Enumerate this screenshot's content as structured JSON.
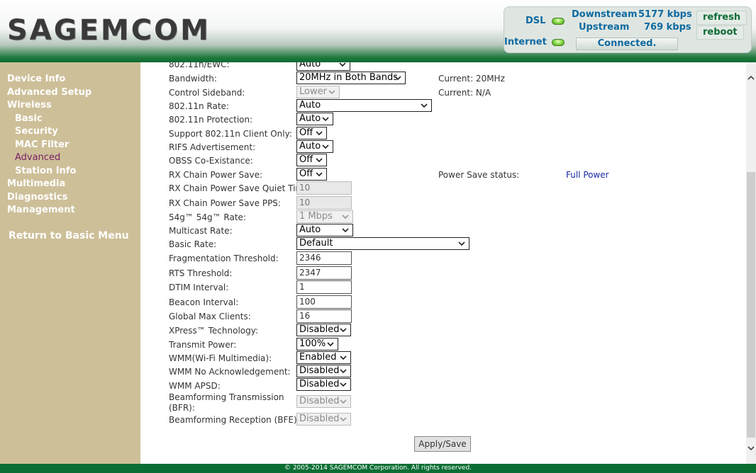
{
  "brand": {
    "logo": "SAGEMCOM"
  },
  "status": {
    "dsl_label": "DSL",
    "internet_label": "Internet",
    "downstream_label": "Downstream",
    "downstream_value": "5177 kbps",
    "upstream_label": "Upstream",
    "upstream_value": "769 kbps",
    "connection": "Connected.",
    "refresh_label": "refresh",
    "reboot_label": "reboot",
    "led_color": "#7ad33b"
  },
  "sidebar": {
    "device_info": "Device Info",
    "advanced_setup": "Advanced Setup",
    "wireless": "Wireless",
    "basic": "Basic",
    "security": "Security",
    "mac_filter": "MAC Filter",
    "advanced": "Advanced",
    "station_info": "Station Info",
    "multimedia": "Multimedia",
    "diagnostics": "Diagnostics",
    "management": "Management",
    "return_label": "Return to Basic Menu"
  },
  "form": {
    "ewc": {
      "label": "802.11n/EWC:",
      "value": "Auto"
    },
    "bandwidth": {
      "label": "Bandwidth:",
      "value": "20MHz in Both Bands",
      "current": "Current: 20MHz"
    },
    "control_sideband": {
      "label": "Control Sideband:",
      "value": "Lower",
      "current": "Current: N/A"
    },
    "n_rate": {
      "label": "802.11n Rate:",
      "value": "Auto"
    },
    "n_protection": {
      "label": "802.11n Protection:",
      "value": "Auto"
    },
    "n_client_only": {
      "label": "Support 802.11n Client Only:",
      "value": "Off"
    },
    "rifs": {
      "label": "RIFS Advertisement:",
      "value": "Auto"
    },
    "obss": {
      "label": "OBSS Co-Existance:",
      "value": "Off"
    },
    "rx_power_save": {
      "label": "RX Chain Power Save:",
      "value": "Off",
      "status_label": "Power Save status:",
      "status_value": "Full Power"
    },
    "rx_quiet_time": {
      "label": "RX Chain Power Save Quiet Time:",
      "value": "10"
    },
    "rx_pps": {
      "label": "RX Chain Power Save PPS:",
      "value": "10"
    },
    "g_rate": {
      "label": "54g™ 54g™ Rate:",
      "value": "1 Mbps"
    },
    "multicast_rate": {
      "label": "Multicast Rate:",
      "value": "Auto"
    },
    "basic_rate": {
      "label": "Basic Rate:",
      "value": "Default"
    },
    "frag_threshold": {
      "label": "Fragmentation Threshold:",
      "value": "2346"
    },
    "rts_threshold": {
      "label": "RTS Threshold:",
      "value": "2347"
    },
    "dtim": {
      "label": "DTIM Interval:",
      "value": "1"
    },
    "beacon": {
      "label": "Beacon Interval:",
      "value": "100"
    },
    "max_clients": {
      "label": "Global Max Clients:",
      "value": "16"
    },
    "xpress": {
      "label": "XPress™ Technology:",
      "value": "Disabled"
    },
    "tx_power": {
      "label": "Transmit Power:",
      "value": "100%"
    },
    "wmm": {
      "label": "WMM(Wi-Fi Multimedia):",
      "value": "Enabled"
    },
    "wmm_noack": {
      "label": "WMM No Acknowledgement:",
      "value": "Disabled"
    },
    "wmm_apsd": {
      "label": "WMM APSD:",
      "value": "Disabled"
    },
    "bfr": {
      "label_line1": "Beamforming Transmission",
      "label_line2": "(BFR):",
      "value": "Disabled"
    },
    "bfe": {
      "label": "Beamforming Reception (BFE):",
      "value": "Disabled"
    },
    "apply_label": "Apply/Save"
  },
  "footer": {
    "copyright": "© 2005-2014 SAGEMCOM Corporation. All rights reserved."
  }
}
